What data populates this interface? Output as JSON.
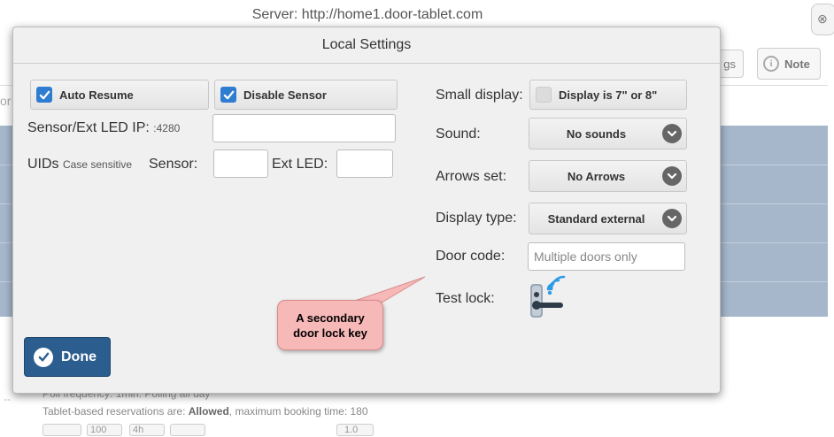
{
  "background": {
    "server_title": "Server: http://home1.door-tablet.com",
    "settings_button_label": "gs",
    "note_button_label": "Note",
    "stub_text": "or",
    "poll_text": "Poll frequency: 1min. Polling all day",
    "reservations_prefix": "Tablet-based reservations are: ",
    "reservations_allowed": "Allowed",
    "reservations_suffix": ", maximum booking time: 180",
    "mini_values": [
      "100",
      "4h",
      "1.0"
    ]
  },
  "modal": {
    "title": "Local Settings",
    "auto_resume_label": "Auto Resume",
    "auto_resume_checked": true,
    "disable_sensor_label": "Disable Sensor",
    "disable_sensor_checked": true,
    "sensor_ip_label": "Sensor/Ext LED IP:",
    "sensor_ip_port": ":4280",
    "sensor_ip_value": "",
    "uids_label": "UIDs",
    "uids_note": "Case sensitive",
    "sensor_label": "Sensor:",
    "sensor_value": "",
    "ext_led_label": "Ext LED:",
    "ext_led_value": "",
    "small_display_label": "Small display:",
    "small_display_option": "Display is 7\" or 8\"",
    "small_display_checked": false,
    "sound_label": "Sound:",
    "sound_value": "No sounds",
    "arrows_label": "Arrows set:",
    "arrows_value": "No Arrows",
    "display_type_label": "Display type:",
    "display_type_value": "Standard external",
    "door_code_label": "Door code:",
    "door_code_placeholder": "Multiple doors only",
    "door_code_value": "",
    "test_lock_label": "Test lock:",
    "done_label": "Done"
  },
  "callout": {
    "line1": "A secondary",
    "line2": "door lock key"
  },
  "colors": {
    "checkbox_blue": "#2e7dd1",
    "done_button": "#2b5d8f",
    "callout_pink": "#f7b8b8",
    "table_rows": "#a6b7cc",
    "lock_icon_blue": "#2e9be6"
  },
  "icons": [
    "check-icon",
    "chevron-down-icon",
    "info-icon",
    "wireless-lock-icon",
    "close-icon"
  ]
}
